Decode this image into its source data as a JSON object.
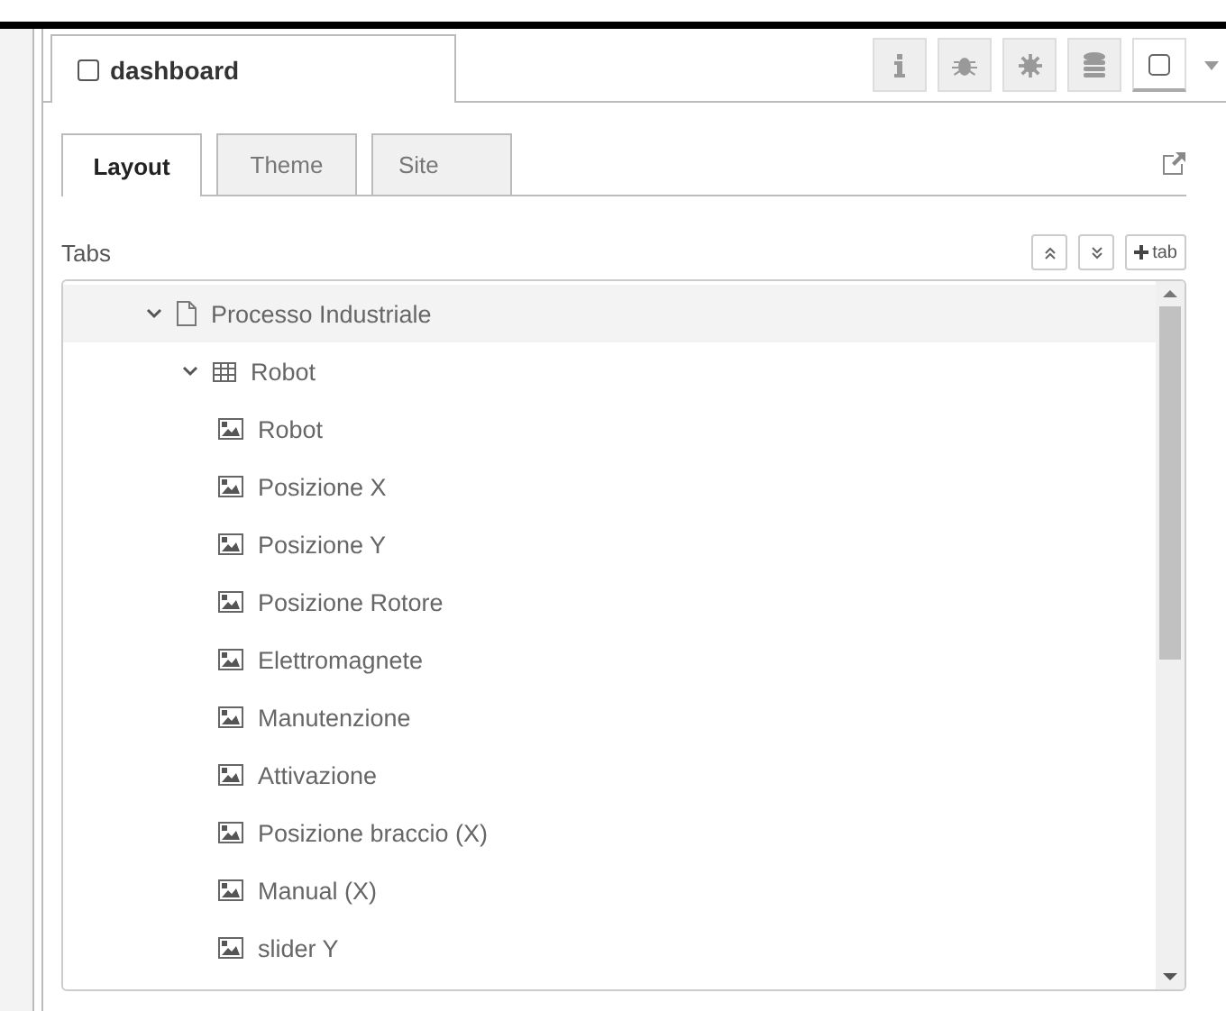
{
  "header_tab": {
    "label": "dashboard",
    "checked": false
  },
  "toolbar": {
    "buttons": [
      {
        "kind": "info",
        "selected": false
      },
      {
        "kind": "bug",
        "selected": false
      },
      {
        "kind": "gear",
        "selected": false
      },
      {
        "kind": "database",
        "selected": false
      },
      {
        "kind": "square",
        "selected": true
      }
    ]
  },
  "subtabs": [
    {
      "label": "Layout",
      "selected": true
    },
    {
      "label": "Theme",
      "selected": false
    },
    {
      "label": "Site",
      "selected": false
    }
  ],
  "section": {
    "label": "Tabs",
    "add_label": "tab"
  },
  "tree": [
    {
      "label": "Processo Industriale",
      "kind": "tab",
      "expanded": true,
      "hovered": true,
      "children": [
        {
          "label": "Robot",
          "kind": "group",
          "expanded": true,
          "hovered": false,
          "children": [
            {
              "label": "Robot",
              "kind": "widget"
            },
            {
              "label": "Posizione X",
              "kind": "widget"
            },
            {
              "label": "Posizione Y",
              "kind": "widget"
            },
            {
              "label": "Posizione Rotore",
              "kind": "widget"
            },
            {
              "label": "Elettromagnete",
              "kind": "widget"
            },
            {
              "label": "Manutenzione",
              "kind": "widget"
            },
            {
              "label": "Attivazione",
              "kind": "widget"
            },
            {
              "label": "Posizione braccio (X)",
              "kind": "widget"
            },
            {
              "label": "Manual (X)",
              "kind": "widget"
            },
            {
              "label": "slider Y",
              "kind": "widget"
            }
          ]
        }
      ]
    }
  ]
}
